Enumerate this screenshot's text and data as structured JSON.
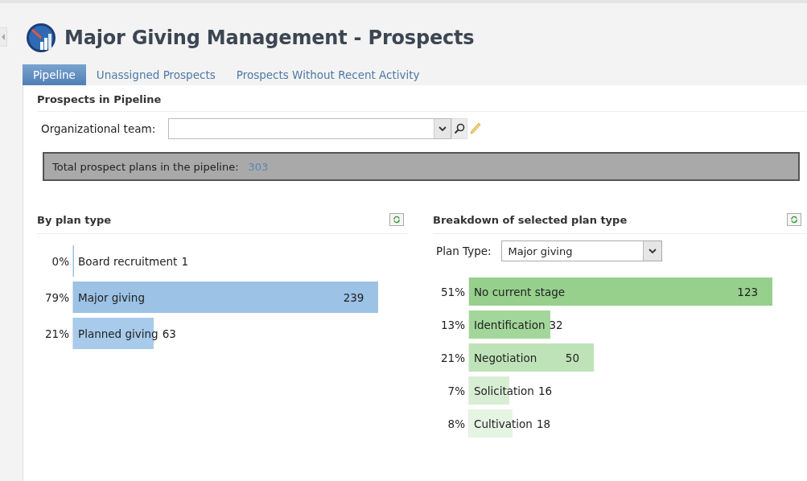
{
  "page": {
    "title": "Major Giving Management - Prospects"
  },
  "tabs": [
    {
      "label": "Pipeline",
      "selected": true
    },
    {
      "label": "Unassigned Prospects",
      "selected": false
    },
    {
      "label": "Prospects Without Recent Activity",
      "selected": false
    }
  ],
  "section": {
    "title": "Prospects in Pipeline"
  },
  "filter": {
    "label": "Organizational team:"
  },
  "total": {
    "label": "Total prospect plans in the pipeline:",
    "value": "303"
  },
  "left_panel": {
    "title": "By plan type",
    "bars": [
      {
        "percent": "0%",
        "label": "Board recruitment",
        "count": "1",
        "level": 0.003,
        "color": "#9cc2e5"
      },
      {
        "percent": "79%",
        "label": "Major giving",
        "count": "239",
        "level": 0.91,
        "color": "#9cc2e5"
      },
      {
        "percent": "21%",
        "label": "Planned giving",
        "count": "63",
        "level": 0.24,
        "color": "#a9cbeb"
      }
    ]
  },
  "right_panel": {
    "title": "Breakdown of selected plan type",
    "plan_type": {
      "label": "Plan Type:",
      "value": "Major giving"
    },
    "bars": [
      {
        "percent": "51%",
        "label": "No current stage",
        "count": "123",
        "level": 0.9,
        "color": "#96d08c"
      },
      {
        "percent": "13%",
        "label": "Identification",
        "count": "32",
        "level": 0.24,
        "color": "#a3d69a"
      },
      {
        "percent": "21%",
        "label": "Negotiation",
        "count": "50",
        "level": 0.37,
        "color": "#bfe3b8"
      },
      {
        "percent": "7%",
        "label": "Solicitation",
        "count": "16",
        "level": 0.12,
        "color": "#d8eed4"
      },
      {
        "percent": "8%",
        "label": "Cultivation",
        "count": "18",
        "level": 0.13,
        "color": "#e6f4e3"
      }
    ]
  }
}
